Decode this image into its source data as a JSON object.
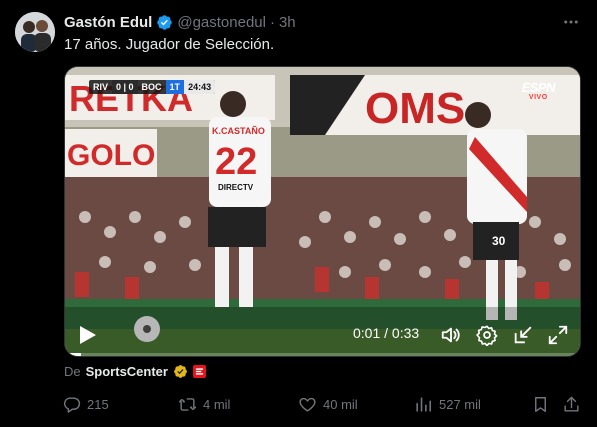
{
  "author": {
    "name": "Gastón Edul",
    "handle": "@gastonedul",
    "separator": "·",
    "time": "3h"
  },
  "tweet": {
    "text": "17 años. Jugador de Selección."
  },
  "video": {
    "scorebug": {
      "home": "RIV",
      "score": "0 | 0",
      "away": "BOC",
      "half": "1T",
      "clock": "24:43"
    },
    "broadcaster": "ESPN",
    "broadcaster_tag": "VIVO",
    "time_display": "0:01 / 0:33",
    "progress_fraction": 0.03,
    "crowd_banner_left": "RETKA",
    "crowd_banner_left2": "GOLO",
    "crowd_banner_right": "OMS",
    "player_name": "K.CASTAÑO",
    "player_number": "22",
    "player_sponsor": "DIRECTV",
    "player2_number": "30"
  },
  "source": {
    "prefix": "De",
    "account": "SportsCenter"
  },
  "actions": {
    "replies": "215",
    "reposts": "4 mil",
    "likes": "40 mil",
    "views": "527 mil"
  },
  "colors": {
    "verified_blue": "#1d9bf0",
    "business_gold": "#e2b719",
    "muted": "#71767b",
    "text": "#e7e9ea",
    "background": "#000000"
  }
}
